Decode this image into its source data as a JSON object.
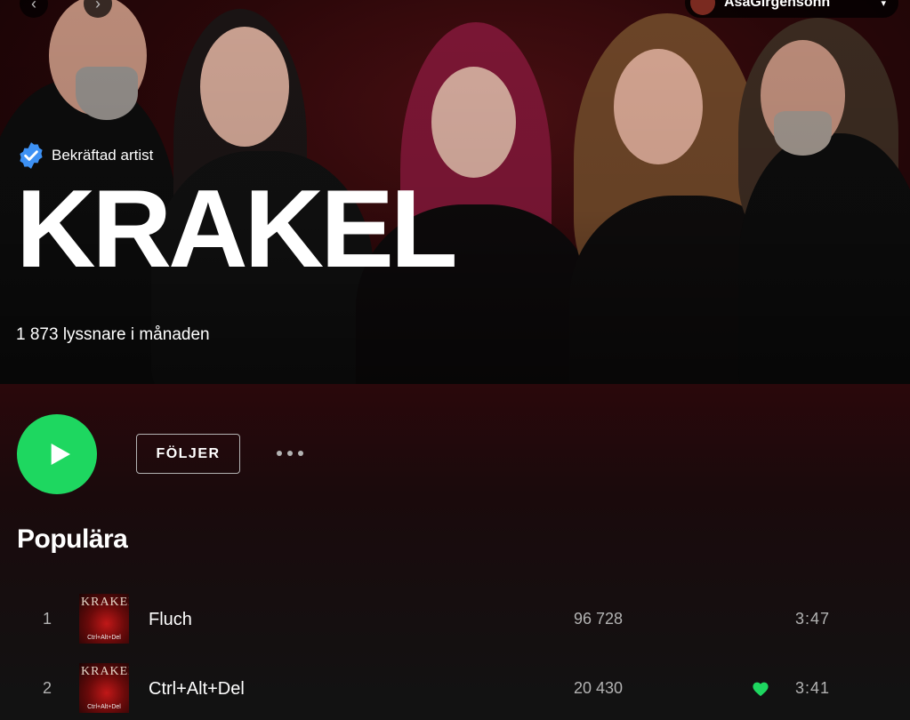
{
  "nav": {
    "back_icon": "chevron-left-icon",
    "forward_icon": "chevron-right-icon",
    "back_glyph": "‹",
    "forward_glyph": "›"
  },
  "user": {
    "name": "AsaGirgensohn",
    "caret_glyph": "▾"
  },
  "artist": {
    "verified_label": "Bekräftad artist",
    "name": "KRAKEL",
    "monthly_listeners": "1 873 lyssnare i månaden"
  },
  "actions": {
    "follow_label": "FÖLJER"
  },
  "popular": {
    "title": "Populära",
    "tracks": [
      {
        "number": "1",
        "cover_logo": "KRAKEL",
        "cover_sub": "Ctrl+Alt+Del",
        "title": "Fluch",
        "plays": "96 728",
        "liked": false,
        "duration": "3:47"
      },
      {
        "number": "2",
        "cover_logo": "KRAKEL",
        "cover_sub": "Ctrl+Alt+Del",
        "title": "Ctrl+Alt+Del",
        "plays": "20 430",
        "liked": true,
        "duration": "3:41"
      }
    ]
  },
  "colors": {
    "accent": "#1ed760",
    "background": "#121212",
    "hero_dark_red": "#2a0709",
    "muted_text": "#b3b3b3"
  }
}
